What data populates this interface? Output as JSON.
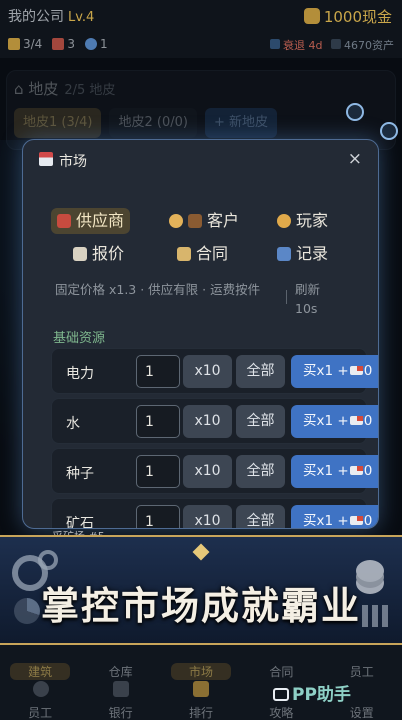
{
  "status": {
    "company": "我的公司",
    "level": "Lv.4",
    "cash": "1000现金",
    "stat_a": "3/4",
    "stat_b": "3",
    "stat_c": "1",
    "recession": "衰退",
    "recession_days": "4d",
    "assets": "4670资产"
  },
  "plots": {
    "title": "地皮",
    "count": "2/5 地皮",
    "tabs": [
      "地皮1 (3/4)",
      "地皮2 (0/0)",
      "+ 新地皮"
    ]
  },
  "modal": {
    "title": "市场",
    "close": "×",
    "tabs": [
      {
        "label": "供应商",
        "icon": "factory-icon"
      },
      {
        "label": "客户",
        "icon": "client-icon"
      },
      {
        "label": "玩家",
        "icon": "handshake-icon"
      },
      {
        "label": "报价",
        "icon": "clipboard-icon"
      },
      {
        "label": "合同",
        "icon": "scroll-icon"
      },
      {
        "label": "记录",
        "icon": "bar-chart-icon"
      }
    ],
    "note": "固定价格 x1.3 · 供应有限 · 运费按件",
    "refresh": "刷新 10s",
    "section": "基础资源",
    "resources": [
      {
        "name": "电力",
        "qty": "1",
        "x10": "x10",
        "all": "全部",
        "buy": "买x1 +",
        "fee": "0"
      },
      {
        "name": "水",
        "qty": "1",
        "x10": "x10",
        "all": "全部",
        "buy": "买x1 +",
        "fee": "0"
      },
      {
        "name": "种子",
        "qty": "1",
        "x10": "x10",
        "all": "全部",
        "buy": "买x1 +",
        "fee": "0"
      },
      {
        "name": "矿石",
        "qty": "1",
        "x10": "x10",
        "all": "全部",
        "buy": "买x1 +",
        "fee": "0"
      }
    ]
  },
  "banner": {
    "text": "掌控市场成就霸业",
    "behind": "采矿场 #5"
  },
  "nav": {
    "row1": [
      "建筑",
      "仓库",
      "市场",
      "合同",
      "员工"
    ],
    "row2": [
      "员工",
      "银行",
      "排行",
      "攻略",
      "设置"
    ],
    "watermark": "PP助手"
  },
  "colors": {
    "accent_gold": "#c9a64a",
    "buy_blue": "#3f73c4",
    "section_green": "#7fb78e",
    "modal_border": "#4e6b93"
  }
}
